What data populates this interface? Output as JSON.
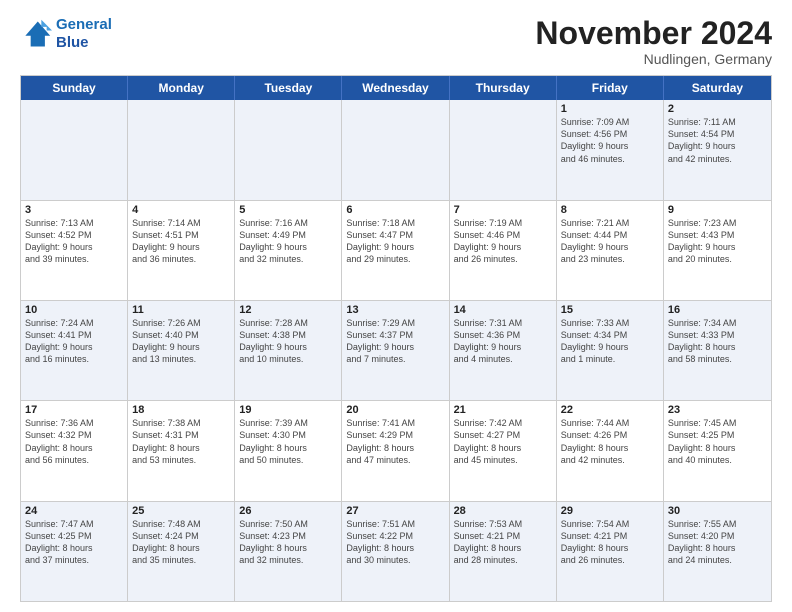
{
  "logo": {
    "line1": "General",
    "line2": "Blue"
  },
  "title": "November 2024",
  "subtitle": "Nudlingen, Germany",
  "header_days": [
    "Sunday",
    "Monday",
    "Tuesday",
    "Wednesday",
    "Thursday",
    "Friday",
    "Saturday"
  ],
  "weeks": [
    [
      {
        "day": "",
        "info": ""
      },
      {
        "day": "",
        "info": ""
      },
      {
        "day": "",
        "info": ""
      },
      {
        "day": "",
        "info": ""
      },
      {
        "day": "",
        "info": ""
      },
      {
        "day": "1",
        "info": "Sunrise: 7:09 AM\nSunset: 4:56 PM\nDaylight: 9 hours\nand 46 minutes."
      },
      {
        "day": "2",
        "info": "Sunrise: 7:11 AM\nSunset: 4:54 PM\nDaylight: 9 hours\nand 42 minutes."
      }
    ],
    [
      {
        "day": "3",
        "info": "Sunrise: 7:13 AM\nSunset: 4:52 PM\nDaylight: 9 hours\nand 39 minutes."
      },
      {
        "day": "4",
        "info": "Sunrise: 7:14 AM\nSunset: 4:51 PM\nDaylight: 9 hours\nand 36 minutes."
      },
      {
        "day": "5",
        "info": "Sunrise: 7:16 AM\nSunset: 4:49 PM\nDaylight: 9 hours\nand 32 minutes."
      },
      {
        "day": "6",
        "info": "Sunrise: 7:18 AM\nSunset: 4:47 PM\nDaylight: 9 hours\nand 29 minutes."
      },
      {
        "day": "7",
        "info": "Sunrise: 7:19 AM\nSunset: 4:46 PM\nDaylight: 9 hours\nand 26 minutes."
      },
      {
        "day": "8",
        "info": "Sunrise: 7:21 AM\nSunset: 4:44 PM\nDaylight: 9 hours\nand 23 minutes."
      },
      {
        "day": "9",
        "info": "Sunrise: 7:23 AM\nSunset: 4:43 PM\nDaylight: 9 hours\nand 20 minutes."
      }
    ],
    [
      {
        "day": "10",
        "info": "Sunrise: 7:24 AM\nSunset: 4:41 PM\nDaylight: 9 hours\nand 16 minutes."
      },
      {
        "day": "11",
        "info": "Sunrise: 7:26 AM\nSunset: 4:40 PM\nDaylight: 9 hours\nand 13 minutes."
      },
      {
        "day": "12",
        "info": "Sunrise: 7:28 AM\nSunset: 4:38 PM\nDaylight: 9 hours\nand 10 minutes."
      },
      {
        "day": "13",
        "info": "Sunrise: 7:29 AM\nSunset: 4:37 PM\nDaylight: 9 hours\nand 7 minutes."
      },
      {
        "day": "14",
        "info": "Sunrise: 7:31 AM\nSunset: 4:36 PM\nDaylight: 9 hours\nand 4 minutes."
      },
      {
        "day": "15",
        "info": "Sunrise: 7:33 AM\nSunset: 4:34 PM\nDaylight: 9 hours\nand 1 minute."
      },
      {
        "day": "16",
        "info": "Sunrise: 7:34 AM\nSunset: 4:33 PM\nDaylight: 8 hours\nand 58 minutes."
      }
    ],
    [
      {
        "day": "17",
        "info": "Sunrise: 7:36 AM\nSunset: 4:32 PM\nDaylight: 8 hours\nand 56 minutes."
      },
      {
        "day": "18",
        "info": "Sunrise: 7:38 AM\nSunset: 4:31 PM\nDaylight: 8 hours\nand 53 minutes."
      },
      {
        "day": "19",
        "info": "Sunrise: 7:39 AM\nSunset: 4:30 PM\nDaylight: 8 hours\nand 50 minutes."
      },
      {
        "day": "20",
        "info": "Sunrise: 7:41 AM\nSunset: 4:29 PM\nDaylight: 8 hours\nand 47 minutes."
      },
      {
        "day": "21",
        "info": "Sunrise: 7:42 AM\nSunset: 4:27 PM\nDaylight: 8 hours\nand 45 minutes."
      },
      {
        "day": "22",
        "info": "Sunrise: 7:44 AM\nSunset: 4:26 PM\nDaylight: 8 hours\nand 42 minutes."
      },
      {
        "day": "23",
        "info": "Sunrise: 7:45 AM\nSunset: 4:25 PM\nDaylight: 8 hours\nand 40 minutes."
      }
    ],
    [
      {
        "day": "24",
        "info": "Sunrise: 7:47 AM\nSunset: 4:25 PM\nDaylight: 8 hours\nand 37 minutes."
      },
      {
        "day": "25",
        "info": "Sunrise: 7:48 AM\nSunset: 4:24 PM\nDaylight: 8 hours\nand 35 minutes."
      },
      {
        "day": "26",
        "info": "Sunrise: 7:50 AM\nSunset: 4:23 PM\nDaylight: 8 hours\nand 32 minutes."
      },
      {
        "day": "27",
        "info": "Sunrise: 7:51 AM\nSunset: 4:22 PM\nDaylight: 8 hours\nand 30 minutes."
      },
      {
        "day": "28",
        "info": "Sunrise: 7:53 AM\nSunset: 4:21 PM\nDaylight: 8 hours\nand 28 minutes."
      },
      {
        "day": "29",
        "info": "Sunrise: 7:54 AM\nSunset: 4:21 PM\nDaylight: 8 hours\nand 26 minutes."
      },
      {
        "day": "30",
        "info": "Sunrise: 7:55 AM\nSunset: 4:20 PM\nDaylight: 8 hours\nand 24 minutes."
      }
    ]
  ]
}
